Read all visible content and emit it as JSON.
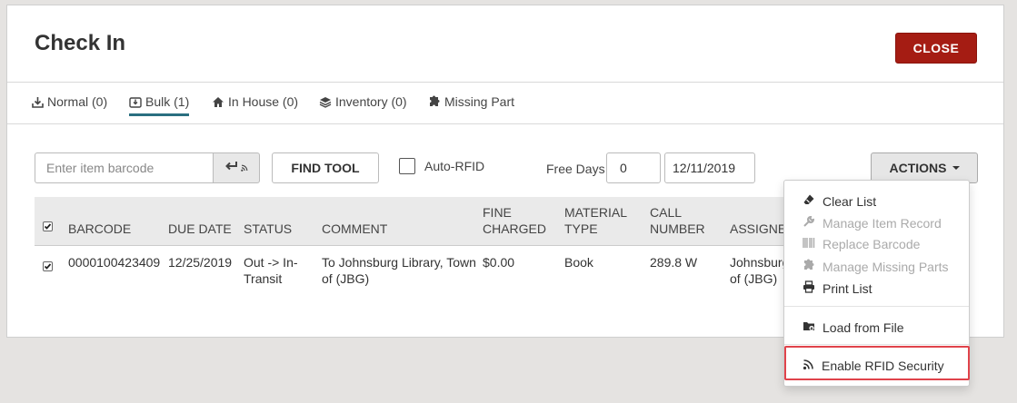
{
  "header": {
    "title": "Check In",
    "close_label": "CLOSE"
  },
  "tabs": [
    {
      "label": "Normal (0)",
      "icon": "download-icon",
      "active": false
    },
    {
      "label": "Bulk (1)",
      "icon": "bulk-icon",
      "active": true
    },
    {
      "label": "In House (0)",
      "icon": "home-icon",
      "active": false
    },
    {
      "label": "Inventory (0)",
      "icon": "layers-icon",
      "active": false
    },
    {
      "label": "Missing Part",
      "icon": "puzzle-icon",
      "active": false
    }
  ],
  "toolbar": {
    "barcode_placeholder": "Enter item barcode",
    "find_tool_label": "FIND TOOL",
    "auto_rfid_label": "Auto-RFID",
    "auto_rfid_checked": false,
    "free_days_label": "Free Days",
    "free_days_value": "0",
    "date_value": "12/11/2019",
    "actions_label": "ACTIONS"
  },
  "table": {
    "columns": {
      "barcode": "BARCODE",
      "due_date": "DUE DATE",
      "status": "STATUS",
      "comment": "COMMENT",
      "fine_1": "FINE",
      "fine_2": "CHARGED",
      "material_1": "MATERIAL",
      "material_2": "TYPE",
      "call_1": "CALL",
      "call_2": "NUMBER",
      "assigned": "ASSIGNED"
    },
    "rows": [
      {
        "checked": true,
        "barcode": "0000100423409",
        "due_date": "12/25/2019",
        "status_1": "Out -> In-",
        "status_2": "Transit",
        "comment_1": "To Johnsburg Library, Town",
        "comment_2": "of (JBG)",
        "fine": "$0.00",
        "material": "Book",
        "call_number": "289.8 W",
        "assigned_1": "Johnsburg L",
        "assigned_2": "of (JBG)"
      }
    ]
  },
  "actions_menu": {
    "items": [
      {
        "label": "Clear List",
        "icon": "eraser-icon",
        "enabled": true
      },
      {
        "label": "Manage Item Record",
        "icon": "wrench-icon",
        "enabled": false
      },
      {
        "label": "Replace Barcode",
        "icon": "barcode-icon",
        "enabled": false
      },
      {
        "label": "Manage Missing Parts",
        "icon": "puzzle-icon",
        "enabled": false
      },
      {
        "label": "Print List",
        "icon": "print-icon",
        "enabled": true
      },
      {
        "label": "Load from File",
        "icon": "folder-icon",
        "enabled": true
      },
      {
        "label": "Enable RFID Security",
        "icon": "rss-icon",
        "enabled": true
      }
    ]
  },
  "colors": {
    "accent": "#2a6f80",
    "close": "#a51c13",
    "highlight": "#e0434b"
  }
}
